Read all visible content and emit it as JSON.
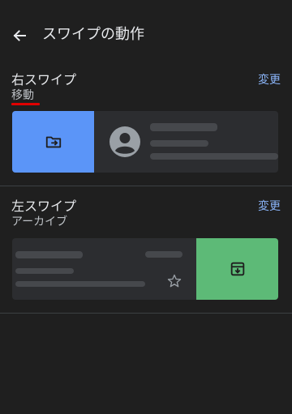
{
  "header": {
    "title": "スワイプの動作",
    "back_icon": "arrow-back-icon"
  },
  "right_swipe": {
    "title": "右スワイプ",
    "subtitle": "移動",
    "change_label": "変更",
    "action_color": "#5b95f8",
    "action_icon": "move-to-folder-icon"
  },
  "left_swipe": {
    "title": "左スワイプ",
    "subtitle": "アーカイブ",
    "change_label": "変更",
    "action_color": "#5dba77",
    "action_icon": "archive-icon"
  },
  "colors": {
    "background": "#1f1f1f",
    "accent": "#8ab4f8",
    "highlight_underline": "#e00000"
  }
}
